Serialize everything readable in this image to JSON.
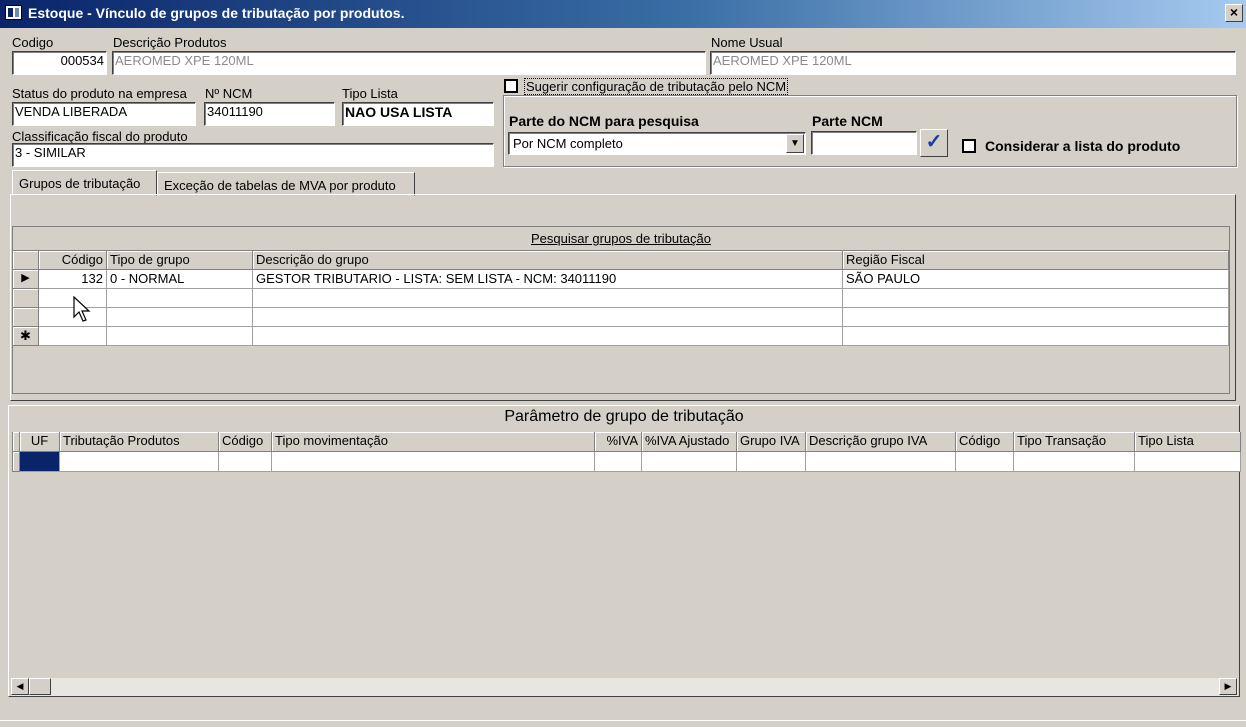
{
  "window": {
    "title": "Estoque - Vínculo de grupos de tributação por produtos.",
    "close_label": "×"
  },
  "product": {
    "codigo_label": "Codigo",
    "codigo_value": "000534",
    "descricao_label": "Descrição  Produtos",
    "descricao_value": "AEROMED XPE 120ML",
    "nome_usual_label": "Nome Usual",
    "nome_usual_value": "AEROMED XPE 120ML",
    "status_label": "Status do produto na empresa",
    "status_value": "VENDA LIBERADA",
    "ncm_label": "Nº NCM",
    "ncm_value": "34011190",
    "tipo_lista_label": "Tipo Lista",
    "tipo_lista_value": "NAO USA LISTA",
    "classificacao_label": "Classificação fiscal do produto",
    "classificacao_value": "3 - SIMILAR"
  },
  "ncm_config": {
    "sugerir_label": "Sugerir configuração de tributação pelo NCM",
    "parte_pesquisa_label": "Parte do NCM para pesquisa",
    "parte_pesquisa_value": "Por NCM completo",
    "parte_ncm_label": "Parte NCM",
    "parte_ncm_value": "",
    "confirm_glyph": "✓",
    "considerar_label": "Considerar a lista do produto"
  },
  "tabs": [
    {
      "label": "Grupos de tributação"
    },
    {
      "label": "Exceção de tabelas de MVA por produto"
    }
  ],
  "grupos_grid": {
    "caption": "Pesquisar grupos de tributação",
    "columns": [
      "Código",
      "Tipo de grupo",
      "Descrição do grupo",
      "Região Fiscal"
    ],
    "rows": [
      [
        "132",
        "0 - NORMAL",
        "GESTOR TRIBUTARIO - LISTA: SEM LISTA - NCM: 34011190",
        "SÃO PAULO"
      ]
    ],
    "current_row_glyph": "▶",
    "new_row_glyph": "✱"
  },
  "parametro_grid": {
    "caption": "Parâmetro de grupo de tributação",
    "columns": [
      "UF",
      "Tributação Produtos",
      "Código",
      "Tipo movimentação",
      "%IVA",
      "%IVA Ajustado",
      "Grupo IVA",
      "Descrição grupo IVA",
      "Código",
      "Tipo Transação",
      "Tipo Lista"
    ]
  },
  "scrollbar": {
    "left_glyph": "◀",
    "right_glyph": "▶"
  },
  "colors": {
    "titlebar_start": "#0a246a",
    "titlebar_end": "#a6caf0",
    "face": "#d4d0c8",
    "selected_cell": "#0a246a"
  }
}
